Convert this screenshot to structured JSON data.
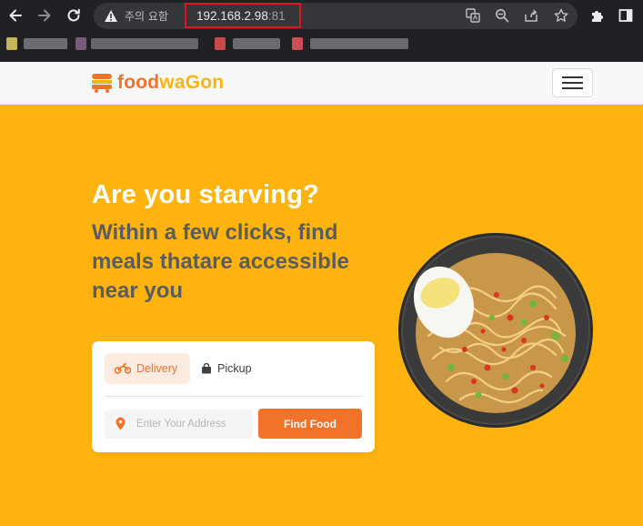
{
  "browser": {
    "security_warning": "주의 요함",
    "url_host": "192.168.2.98",
    "url_port": ":81"
  },
  "site": {
    "logo_food": "food",
    "logo_wagon": "waGon"
  },
  "hero": {
    "title": "Are you starving?",
    "subtitle": "Within a few clicks, find meals thatare accessible near you"
  },
  "search_card": {
    "tab_delivery": "Delivery",
    "tab_pickup": "Pickup",
    "address_placeholder": "Enter Your Address",
    "find_button": "Find Food"
  },
  "colors": {
    "accent_orange": "#f17228",
    "hero_yellow": "#ffb30e",
    "url_highlight": "#e5131b"
  }
}
